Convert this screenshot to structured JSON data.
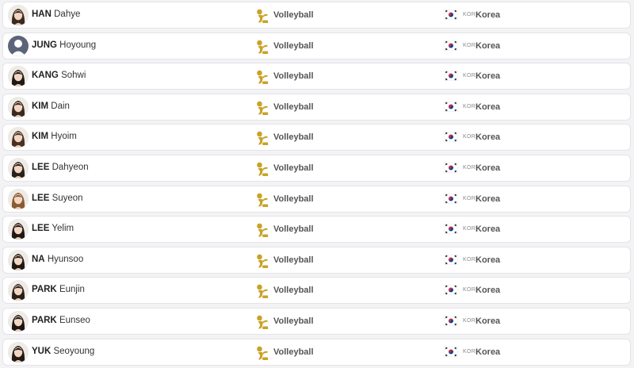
{
  "athletes": [
    {
      "last": "HAN",
      "first": "Dahye",
      "sport": "Volleyball",
      "code": "KOR",
      "country": "Korea",
      "avatar": "photo"
    },
    {
      "last": "JUNG",
      "first": "Hoyoung",
      "sport": "Volleyball",
      "code": "KOR",
      "country": "Korea",
      "avatar": "placeholder"
    },
    {
      "last": "KANG",
      "first": "Sohwi",
      "sport": "Volleyball",
      "code": "KOR",
      "country": "Korea",
      "avatar": "photo"
    },
    {
      "last": "KIM",
      "first": "Dain",
      "sport": "Volleyball",
      "code": "KOR",
      "country": "Korea",
      "avatar": "photo"
    },
    {
      "last": "KIM",
      "first": "Hyoim",
      "sport": "Volleyball",
      "code": "KOR",
      "country": "Korea",
      "avatar": "photo"
    },
    {
      "last": "LEE",
      "first": "Dahyeon",
      "sport": "Volleyball",
      "code": "KOR",
      "country": "Korea",
      "avatar": "photo"
    },
    {
      "last": "LEE",
      "first": "Suyeon",
      "sport": "Volleyball",
      "code": "KOR",
      "country": "Korea",
      "avatar": "photo"
    },
    {
      "last": "LEE",
      "first": "Yelim",
      "sport": "Volleyball",
      "code": "KOR",
      "country": "Korea",
      "avatar": "photo"
    },
    {
      "last": "NA",
      "first": "Hyunsoo",
      "sport": "Volleyball",
      "code": "KOR",
      "country": "Korea",
      "avatar": "photo"
    },
    {
      "last": "PARK",
      "first": "Eunjin",
      "sport": "Volleyball",
      "code": "KOR",
      "country": "Korea",
      "avatar": "photo"
    },
    {
      "last": "PARK",
      "first": "Eunseo",
      "sport": "Volleyball",
      "code": "KOR",
      "country": "Korea",
      "avatar": "photo"
    },
    {
      "last": "YUK",
      "first": "Seoyoung",
      "sport": "Volleyball",
      "code": "KOR",
      "country": "Korea",
      "avatar": "photo"
    }
  ],
  "icons": {
    "sport": "volleyball-pictogram-icon",
    "flag": "korea-flag-icon"
  },
  "colors": {
    "sport_icon": "#c9a227",
    "placeholder_avatar": "#5b6478",
    "row_border": "#e4e4e8",
    "background": "#f3f3f5"
  }
}
